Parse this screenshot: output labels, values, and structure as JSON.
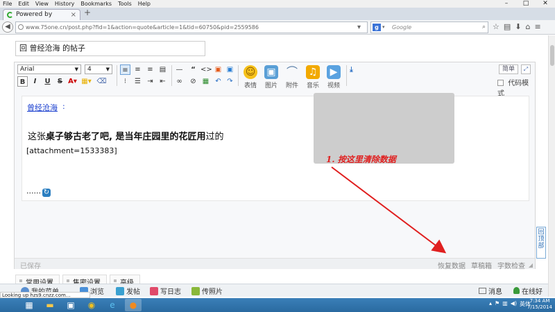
{
  "menubar": {
    "items": [
      "File",
      "Edit",
      "View",
      "History",
      "Bookmarks",
      "Tools",
      "Help"
    ]
  },
  "window_controls": [
    "–",
    "□",
    "✕"
  ],
  "browser": {
    "tab_title": "Powered by phpwind",
    "tab_close": "×",
    "new_tab": "+",
    "url": "www.75one.cn/post.php?fid=1&action=quote&article=1&tid=60750&pid=2559586",
    "search_placeholder": "Google",
    "search_engine": "g",
    "status_text": "Looking up hzs9.cnzz.com...",
    "accent": "#3a3a3a"
  },
  "post": {
    "title_value": "回 曾经沧海 的帖子"
  },
  "editor": {
    "font_family": "Arial",
    "font_size": "4",
    "big_buttons": [
      {
        "label": "表情",
        "icon": "smiley-icon",
        "color": "#f6c21b",
        "glyph": "☺"
      },
      {
        "label": "图片",
        "icon": "image-icon",
        "color": "#5a9fd6",
        "glyph": "▣"
      },
      {
        "label": "附件",
        "icon": "paperclip-icon",
        "color": "#ffffff",
        "glyph": "⌒"
      },
      {
        "label": "音乐",
        "icon": "music-icon",
        "color": "#f2a900",
        "glyph": "♫"
      },
      {
        "label": "视频",
        "icon": "video-icon",
        "color": "#5aa2e0",
        "glyph": "▶"
      }
    ],
    "simple_label": "简单",
    "code_mode_label": "代码模式",
    "content": {
      "quote_author": "曾经沧海",
      "quote_colon": ":",
      "line1_prefix": "这张",
      "line1_bold": "桌子够古老了吧, 是当年庄园里的花匠用",
      "line1_suffix": "过的",
      "attachment": "[attachment=1533383]",
      "ellipsis": "......"
    },
    "annotation": "1. 按这里清除数据",
    "status": {
      "saved": "已保存",
      "restore": "恢复数据",
      "drafts": "草稿箱",
      "word_count": "字数检查"
    }
  },
  "back_to_top": "回顶部",
  "settings_tabs": [
    "常用设置",
    "售密设置",
    "高级"
  ],
  "bottom_toolbar": {
    "items": [
      {
        "label": "我的菜单",
        "icon": "menu-icon"
      },
      {
        "label": "浏览",
        "icon": "browse-icon"
      },
      {
        "label": "发帖",
        "icon": "post-icon"
      },
      {
        "label": "写日志",
        "icon": "diary-icon"
      },
      {
        "label": "传照片",
        "icon": "photo-icon"
      }
    ],
    "messages": "消息",
    "online_friends": "在线好友"
  },
  "taskbar": {
    "time": "7:34 AM",
    "date": "7/15/2014",
    "ime": "英体"
  }
}
